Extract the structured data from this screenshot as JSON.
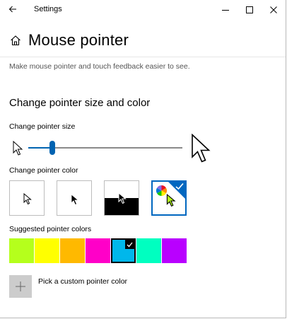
{
  "window": {
    "app_title": "Settings"
  },
  "header": {
    "title": "Mouse pointer"
  },
  "description": "Make mouse pointer and touch feedback easier to see.",
  "section_title": "Change pointer size and color",
  "pointer_size": {
    "label": "Change pointer size",
    "value": 2,
    "min": 1,
    "max": 15
  },
  "pointer_color": {
    "label": "Change pointer color",
    "options": [
      {
        "name": "white",
        "selected": false
      },
      {
        "name": "black",
        "selected": false
      },
      {
        "name": "inverted",
        "selected": false
      },
      {
        "name": "custom",
        "selected": true
      }
    ]
  },
  "suggested": {
    "label": "Suggested pointer colors",
    "colors": [
      "#b5ff1c",
      "#ffff00",
      "#ffb900",
      "#ff00c8",
      "#00b7eb",
      "#00ffc0",
      "#b900ff"
    ],
    "selected_index": 4
  },
  "custom_color": {
    "label": "Pick a custom pointer color"
  },
  "accent_color": "#0067c0",
  "current_pointer_color": "#b5ff1c"
}
